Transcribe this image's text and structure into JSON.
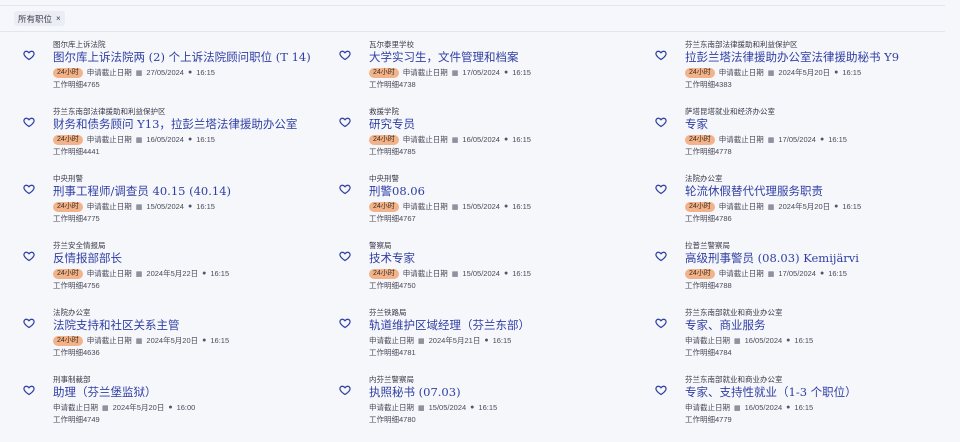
{
  "filter": {
    "label": "所有职位",
    "close": "×"
  },
  "labels": {
    "deadline": "申请截止日期",
    "job_id": "工作明细"
  },
  "badge_text": "24小时",
  "jobs": [
    {
      "org": "图尔库上诉法院",
      "title": "图尔库上诉法院两 (2) 个上诉法院顾问职位 (T 14)",
      "badge": true,
      "date": "27/05/2024",
      "time": "16:15",
      "id": "4765"
    },
    {
      "org": "瓦尔泰里学校",
      "title": "大学实习生，文件管理和档案",
      "badge": true,
      "date": "17/05/2024",
      "time": "16:15",
      "id": "4738"
    },
    {
      "org": "芬兰东南部法律援助和利益保护区",
      "title": "拉彭兰塔法律援助办公室法律援助秘书 Y9",
      "badge": true,
      "date": "2024年5月20日",
      "time": "16:15",
      "id": "4383"
    },
    {
      "org": "芬兰东南部法律援助和利益保护区",
      "title": "财务和债务顾问 Y13，拉彭兰塔法律援助办公室",
      "badge": true,
      "date": "16/05/2024",
      "time": "16:15",
      "id": "4441"
    },
    {
      "org": "救援学院",
      "title": "研究专员",
      "badge": true,
      "date": "16/05/2024",
      "time": "16:15",
      "id": "4785"
    },
    {
      "org": "萨塔昆塔就业和经济办公室",
      "title": "专家",
      "badge": true,
      "date": "17/05/2024",
      "time": "16:15",
      "id": "4778"
    },
    {
      "org": "中央刑警",
      "title": "刑事工程师/调查员 40.15 (40.14)",
      "badge": true,
      "date": "15/05/2024",
      "time": "16:15",
      "id": "4775"
    },
    {
      "org": "中央刑警",
      "title": "刑警08.06",
      "badge": true,
      "date": "15/05/2024",
      "time": "16:15",
      "id": "4767"
    },
    {
      "org": "法院办公室",
      "title": "轮流休假替代代理服务职责",
      "badge": true,
      "date": "2024年5月20日",
      "time": "16:15",
      "id": "4786"
    },
    {
      "org": "芬兰安全情报局",
      "title": "反情报部部长",
      "badge": true,
      "date": "2024年5月22日",
      "time": "16:15",
      "id": "4756"
    },
    {
      "org": "警察局",
      "title": "技术专家",
      "badge": true,
      "date": "15/05/2024",
      "time": "16:15",
      "id": "4750"
    },
    {
      "org": "拉普兰警察局",
      "title": "高级刑事警员 (08.03) Kemijärvi",
      "badge": true,
      "date": "17/05/2024",
      "time": "16:15",
      "id": "4788"
    },
    {
      "org": "法院办公室",
      "title": "法院支持和社区关系主管",
      "badge": true,
      "date": "2024年5月20日",
      "time": "16:15",
      "id": "4636"
    },
    {
      "org": "芬兰铁路局",
      "title": "轨道维护区域经理（芬兰东部）",
      "badge": false,
      "date": "2024年5月21日",
      "time": "16:15",
      "id": "4781"
    },
    {
      "org": "芬兰东南部就业和商业办公室",
      "title": "专家、商业服务",
      "badge": false,
      "date": "16/05/2024",
      "time": "16:15",
      "id": "4784"
    },
    {
      "org": "刑事制裁部",
      "title": "助理（芬兰堡监狱）",
      "badge": false,
      "date": "2024年5月20日",
      "time": "16:00",
      "id": "4749"
    },
    {
      "org": "内芬兰警察局",
      "title": "执照秘书 (07.03)",
      "badge": false,
      "date": "15/05/2024",
      "time": "16:15",
      "id": "4780"
    },
    {
      "org": "芬兰东南部就业和商业办公室",
      "title": "专家、支持性就业（1-3 个职位）",
      "badge": false,
      "date": "16/05/2024",
      "time": "16:15",
      "id": "4779"
    }
  ]
}
